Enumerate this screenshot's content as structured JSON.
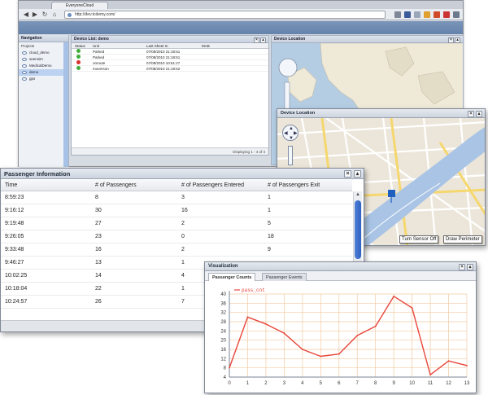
{
  "browser": {
    "tab_title": "EveryoneCloud",
    "url": "http://dev.tcdemy.com/"
  },
  "navigation": {
    "title": "Navigation",
    "projects_label": "Projects",
    "projects": [
      "cloud_demo",
      "seensim",
      "MedicalDemo",
      "demo",
      "gps"
    ],
    "selected_index": 3
  },
  "device_list": {
    "title": "Device List: demo",
    "columns": [
      "Status",
      "Unit",
      "Last Sheet In",
      "MAB"
    ],
    "rows": [
      {
        "status": "green",
        "unit": "Parked",
        "time": "07/08/2010 21:18:51"
      },
      {
        "status": "green",
        "unit": "Parked",
        "time": "07/08/2010 21:18:51"
      },
      {
        "status": "red",
        "unit": "onroute",
        "time": "07/08/2010 10:51:27"
      },
      {
        "status": "green",
        "unit": "moverson",
        "time": "07/08/2010 21:18:52"
      }
    ],
    "footer": "Displaying 1 - 4 of 4"
  },
  "background_map": {
    "title": "Device Location"
  },
  "device_location": {
    "title": "Device Location",
    "turn_sensor_button": "Turn Sensor Off",
    "draw_perimeter_button": "Draw Perimeter"
  },
  "passenger_info": {
    "title": "Passenger Information",
    "columns": [
      "Time",
      "# of Passengers",
      "# of Passengers Entered",
      "# of Passengers Exit"
    ],
    "rows": [
      [
        "8:59:23",
        "8",
        "3",
        "1"
      ],
      [
        "9:16:12",
        "30",
        "16",
        "1"
      ],
      [
        "9:19:48",
        "27",
        "2",
        "5"
      ],
      [
        "9:26:05",
        "23",
        "0",
        "18"
      ],
      [
        "9:33:48",
        "16",
        "2",
        "9"
      ],
      [
        "9:46:27",
        "13",
        "1",
        ""
      ],
      [
        "10:02:25",
        "14",
        "4",
        ""
      ],
      [
        "10:18:04",
        "22",
        "1",
        ""
      ],
      [
        "10:24:57",
        "26",
        "7",
        ""
      ]
    ]
  },
  "visualization": {
    "title": "Visualization",
    "tabs": [
      "Passenger Counts",
      "Passenger Events"
    ],
    "active_tab": 0,
    "colors": {
      "line": "#e8463a",
      "grid": "#f3c9a0",
      "axis": "#7a8596"
    },
    "chart_data": {
      "type": "line",
      "x": [
        0,
        1,
        2,
        3,
        4,
        5,
        6,
        7,
        8,
        9,
        10,
        11,
        12,
        13
      ],
      "series": [
        {
          "name": "pass_cnt",
          "values": [
            8,
            30,
            27,
            23,
            16,
            13,
            14,
            22,
            26,
            39,
            34,
            5,
            11,
            9
          ]
        }
      ],
      "xlim": [
        0,
        13
      ],
      "ylim": [
        4,
        40
      ],
      "yticks": [
        4,
        8,
        12,
        16,
        20,
        24,
        28,
        32,
        36,
        40
      ],
      "xticks": [
        0,
        1,
        2,
        3,
        4,
        5,
        6,
        7,
        8,
        9,
        10,
        11,
        12,
        13
      ],
      "grid": true,
      "legend": "top-left"
    }
  }
}
